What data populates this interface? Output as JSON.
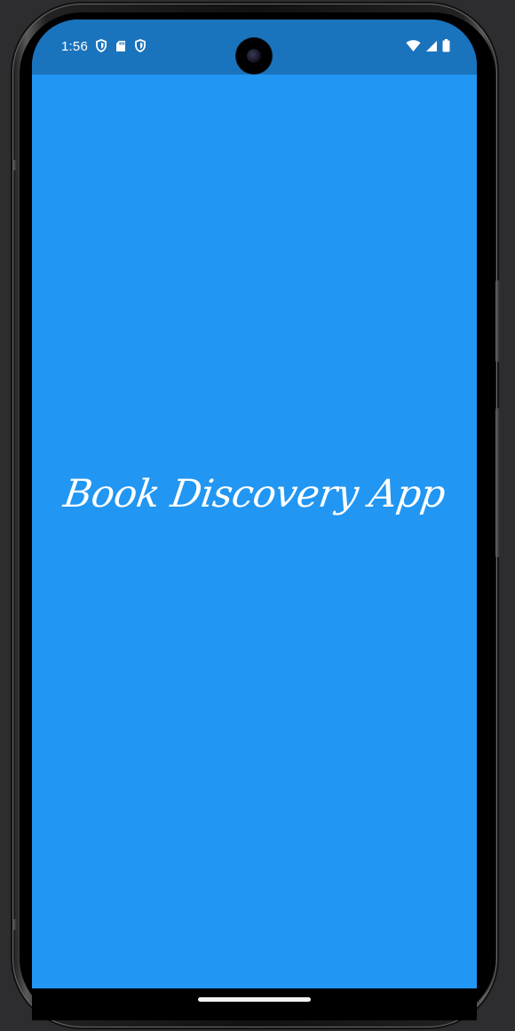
{
  "status_bar": {
    "time": "1:56",
    "left_icons": [
      "shield-icon",
      "sd-card-icon",
      "shield-icon"
    ],
    "right_icons": [
      "wifi-icon",
      "cell-signal-icon",
      "battery-icon"
    ],
    "background_color": "#1a73bd"
  },
  "splash": {
    "title": "Book Discovery App",
    "background_color": "#2196f2",
    "text_color": "#ffffff"
  }
}
